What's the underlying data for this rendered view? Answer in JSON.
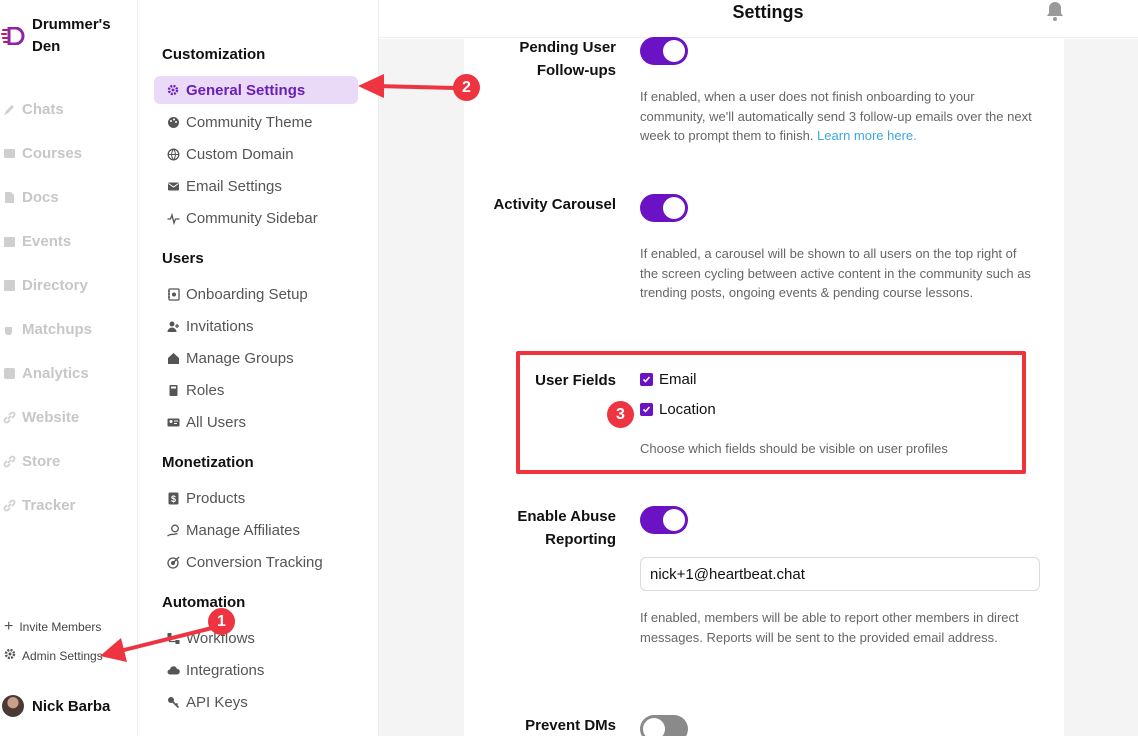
{
  "brand": {
    "name": "Drummer's Den"
  },
  "leftnav": {
    "items": [
      {
        "label": "Chats",
        "icon": "chat-icon"
      },
      {
        "label": "Courses",
        "icon": "courses-icon"
      },
      {
        "label": "Docs",
        "icon": "docs-icon"
      },
      {
        "label": "Events",
        "icon": "calendar-icon"
      },
      {
        "label": "Directory",
        "icon": "directory-icon"
      },
      {
        "label": "Matchups",
        "icon": "coffee-icon"
      },
      {
        "label": "Analytics",
        "icon": "analytics-icon"
      },
      {
        "label": "Website",
        "icon": "link-icon"
      },
      {
        "label": "Store",
        "icon": "link-icon"
      },
      {
        "label": "Tracker",
        "icon": "link-icon"
      }
    ],
    "invite_members": "Invite Members",
    "admin_settings": "Admin Settings",
    "user_name": "Nick Barba"
  },
  "settings_nav": {
    "sections": [
      {
        "title": "Customization",
        "items": [
          {
            "label": "General Settings",
            "icon": "gear-icon",
            "active": true
          },
          {
            "label": "Community Theme",
            "icon": "palette-icon"
          },
          {
            "label": "Custom Domain",
            "icon": "globe-icon"
          },
          {
            "label": "Email Settings",
            "icon": "mail-icon"
          },
          {
            "label": "Community Sidebar",
            "icon": "pulse-icon"
          }
        ]
      },
      {
        "title": "Users",
        "items": [
          {
            "label": "Onboarding Setup",
            "icon": "notebook-icon"
          },
          {
            "label": "Invitations",
            "icon": "user-plus-icon"
          },
          {
            "label": "Manage Groups",
            "icon": "house-icon"
          },
          {
            "label": "Roles",
            "icon": "book-icon"
          },
          {
            "label": "All Users",
            "icon": "id-card-icon"
          }
        ]
      },
      {
        "title": "Monetization",
        "items": [
          {
            "label": "Products",
            "icon": "dollar-icon"
          },
          {
            "label": "Manage Affiliates",
            "icon": "handshake-icon"
          },
          {
            "label": "Conversion Tracking",
            "icon": "target-icon"
          }
        ]
      },
      {
        "title": "Automation",
        "items": [
          {
            "label": "Workflows",
            "icon": "workflow-icon"
          },
          {
            "label": "Integrations",
            "icon": "cloud-icon"
          },
          {
            "label": "API Keys",
            "icon": "key-icon"
          }
        ]
      }
    ]
  },
  "header": {
    "title": "Settings"
  },
  "settings": {
    "pending_followups": {
      "label": "Pending User Follow-ups",
      "enabled": true,
      "description": "If enabled, when a user does not finish onboarding to your community, we'll automatically send 3 follow-up emails over the next week to prompt them to finish.",
      "link_text": "Learn more here."
    },
    "activity_carousel": {
      "label": "Activity Carousel",
      "enabled": true,
      "description": "If enabled, a carousel will be shown to all users on the top right of the screen cycling between active content in the community such as trending posts, ongoing events & pending course lessons."
    },
    "user_fields": {
      "label": "User Fields",
      "options": [
        {
          "label": "Email",
          "checked": true
        },
        {
          "label": "Location",
          "checked": true
        }
      ],
      "description": "Choose which fields should be visible on user profiles"
    },
    "abuse_reporting": {
      "label": "Enable Abuse Reporting",
      "enabled": true,
      "email_value": "nick+1@heartbeat.chat",
      "description": "If enabled, members will be able to report other members in direct messages. Reports will be sent to the provided email address."
    },
    "prevent_dms": {
      "label": "Prevent DMs",
      "enabled": false
    }
  },
  "annotations": {
    "badge_1": "1",
    "badge_2": "2",
    "badge_3": "3",
    "color": "#ee3440"
  },
  "colors": {
    "accent": "#6a12c4",
    "active_bg": "#ead9f7",
    "link": "#3ea6e0"
  }
}
